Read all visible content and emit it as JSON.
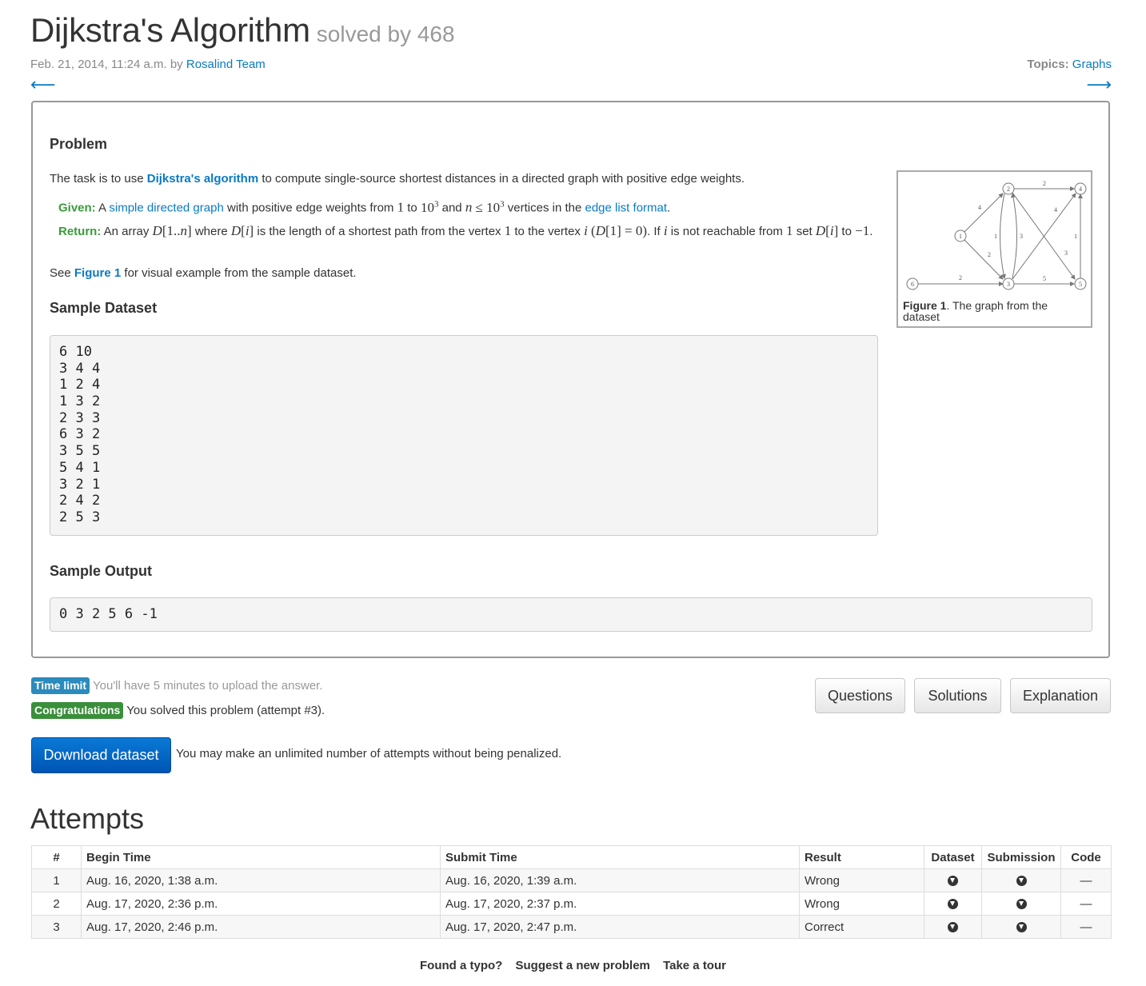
{
  "header": {
    "title": "Dijkstra's Algorithm",
    "solved": "solved by 468",
    "date": "Feb. 21, 2014, 11:24 a.m. by",
    "author": "Rosalind Team",
    "topics_label": "Topics:",
    "topics_link": "Graphs",
    "prev_arrow": "⟵",
    "next_arrow": "⟶"
  },
  "problem": {
    "heading": "Problem",
    "intro_pre": "The task is to use",
    "intro_link": "Dijkstra's algorithm",
    "intro_post": "to compute single-source shortest distances in a directed graph with positive edge weights.",
    "given_label": "Given:",
    "given_a": "A",
    "given_link1": "simple directed graph",
    "given_mid": "with positive edge weights from",
    "given_link2": "edge list format",
    "given_end": "vertices in the",
    "return_label": "Return:",
    "see_pre": "See",
    "see_link": "Figure 1",
    "see_post": "for visual example from the sample dataset."
  },
  "figure": {
    "caption_bold": "Figure 1",
    "caption_text": ". The graph from the dataset"
  },
  "sample_dataset": {
    "heading": "Sample Dataset",
    "lines": [
      "6 10",
      "3 4 4",
      "1 2 4",
      "1 3 2",
      "2 3 3",
      "6 3 2",
      "3 5 5",
      "5 4 1",
      "3 2 1",
      "2 4 2",
      "2 5 3"
    ]
  },
  "sample_output": {
    "heading": "Sample Output",
    "value": "0 3 2 5 6 -1"
  },
  "status": {
    "time_label": "Time limit",
    "time_text": "You'll have 5 minutes to upload the answer.",
    "congrats_label": "Congratulations",
    "congrats_text": "You solved this problem (attempt #3)."
  },
  "buttons": {
    "questions": "Questions",
    "solutions": "Solutions",
    "explanation": "Explanation",
    "download": "Download dataset",
    "download_note": "You may make an unlimited number of attempts without being penalized."
  },
  "attempts": {
    "heading": "Attempts",
    "columns": [
      "#",
      "Begin Time",
      "Submit Time",
      "Result",
      "Dataset",
      "Submission",
      "Code"
    ],
    "rows": [
      {
        "num": "1",
        "begin": "Aug. 16, 2020, 1:38 a.m.",
        "submit": "Aug. 16, 2020, 1:39 a.m.",
        "result": "Wrong",
        "code": "—"
      },
      {
        "num": "2",
        "begin": "Aug. 17, 2020, 2:36 p.m.",
        "submit": "Aug. 17, 2020, 2:37 p.m.",
        "result": "Wrong",
        "code": "—"
      },
      {
        "num": "3",
        "begin": "Aug. 17, 2020, 2:46 p.m.",
        "submit": "Aug. 17, 2020, 2:47 p.m.",
        "result": "Correct",
        "code": "—"
      }
    ]
  },
  "footer": {
    "typo": "Found a typo?",
    "suggest": "Suggest a new problem",
    "tour": "Take a tour"
  }
}
